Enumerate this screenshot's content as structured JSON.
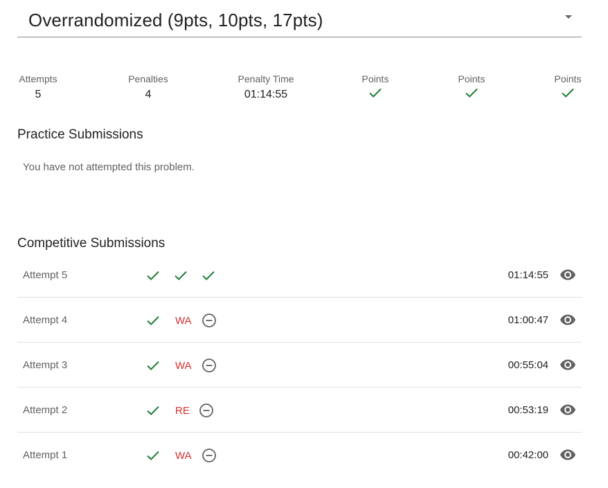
{
  "problem_select": {
    "title": "Overrandomized (9pts, 10pts, 17pts)",
    "caret_icon": "caret-down-icon"
  },
  "stats": {
    "attempts_label": "Attempts",
    "attempts_value": "5",
    "penalties_label": "Penalties",
    "penalties_value": "4",
    "penalty_time_label": "Penalty Time",
    "penalty_time_value": "01:14:55",
    "points": [
      {
        "label": "Points",
        "icon": "check-icon"
      },
      {
        "label": "Points",
        "icon": "check-icon"
      },
      {
        "label": "Points",
        "icon": "check-icon"
      }
    ]
  },
  "practice": {
    "title": "Practice Submissions",
    "empty_text": "You have not attempted this problem."
  },
  "competitive": {
    "title": "Competitive Submissions",
    "rows": [
      {
        "attempt": "Attempt 5",
        "verdicts": [
          {
            "type": "ok"
          },
          {
            "type": "ok"
          },
          {
            "type": "ok"
          }
        ],
        "time": "01:14:55"
      },
      {
        "attempt": "Attempt 4",
        "verdicts": [
          {
            "type": "ok"
          },
          {
            "type": "err",
            "text": "WA"
          },
          {
            "type": "skip"
          }
        ],
        "time": "01:00:47"
      },
      {
        "attempt": "Attempt 3",
        "verdicts": [
          {
            "type": "ok"
          },
          {
            "type": "err",
            "text": "WA"
          },
          {
            "type": "skip"
          }
        ],
        "time": "00:55:04"
      },
      {
        "attempt": "Attempt 2",
        "verdicts": [
          {
            "type": "ok"
          },
          {
            "type": "err",
            "text": "RE"
          },
          {
            "type": "skip"
          }
        ],
        "time": "00:53:19"
      },
      {
        "attempt": "Attempt 1",
        "verdicts": [
          {
            "type": "ok"
          },
          {
            "type": "err",
            "text": "WA"
          },
          {
            "type": "skip"
          }
        ],
        "time": "00:42:00"
      }
    ]
  },
  "colors": {
    "check_green": "#1e7e34",
    "error_red": "#d32f2f",
    "icon_gray": "#616161",
    "divider": "#e0e0e0"
  }
}
